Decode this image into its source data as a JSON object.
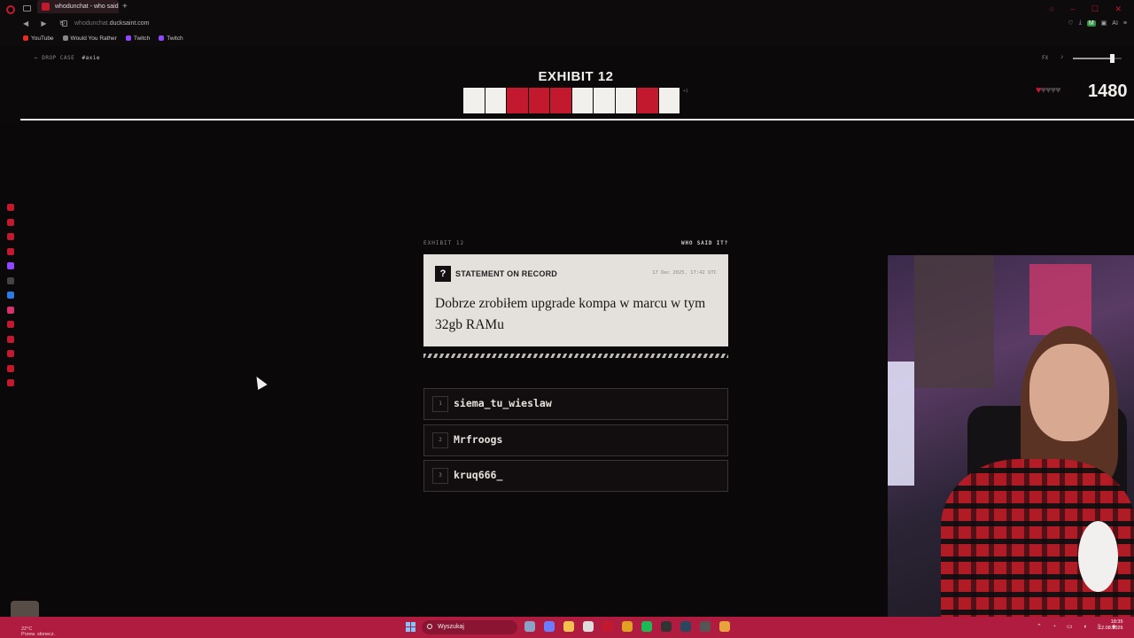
{
  "browser": {
    "tab_title": "whodunchat - who said",
    "url_host": "whodunchat.",
    "url_domain": "ducksaint.com",
    "bookmarks": [
      {
        "label": "YouTube",
        "color": "#e52d27"
      },
      {
        "label": "Would You Rather",
        "color": "#888888"
      },
      {
        "label": "Twitch",
        "color": "#9146ff"
      },
      {
        "label": "Twitch",
        "color": "#9146ff"
      }
    ],
    "extension_badge": "M",
    "extension_label": "AI"
  },
  "game": {
    "back_label": "← DROP CASE",
    "channel": "#axie",
    "exhibit_title": "EXHIBIT 12",
    "tiles": [
      "w",
      "w",
      "r",
      "r",
      "r",
      "w",
      "w",
      "w",
      "r",
      "w"
    ],
    "tiles_note": "+1",
    "fx_label": "FX",
    "music_icon": "♪",
    "volume": 0.8,
    "hearts_total": 5,
    "hearts_remaining": 1,
    "score": "1480"
  },
  "card": {
    "meta_left": "EXHIBIT 12",
    "meta_right": "WHO SAID IT?",
    "badge": "?",
    "label": "STATEMENT ON RECORD",
    "date": "17 Dec 2025, 17:42 UTC",
    "text": "Dobrze zrobiłem upgrade kompa w marcu w tym 32gb RAMu"
  },
  "answers": [
    {
      "num": "1",
      "name": "siema_tu_wieslaw"
    },
    {
      "num": "2",
      "name": "Mrfroogs"
    },
    {
      "num": "3",
      "name": "kruq666_"
    }
  ],
  "taskbar": {
    "weather_temp": "22°C",
    "weather_desc": "Przew. słonecz.",
    "search_placeholder": "Wyszukaj",
    "time": "18:35",
    "date": "12.08.2026",
    "accent": "#b01c3f"
  },
  "colors": {
    "accent_red": "#c2192f",
    "tile_white": "#f2f0ec",
    "card_bg": "#e4e1dc"
  }
}
